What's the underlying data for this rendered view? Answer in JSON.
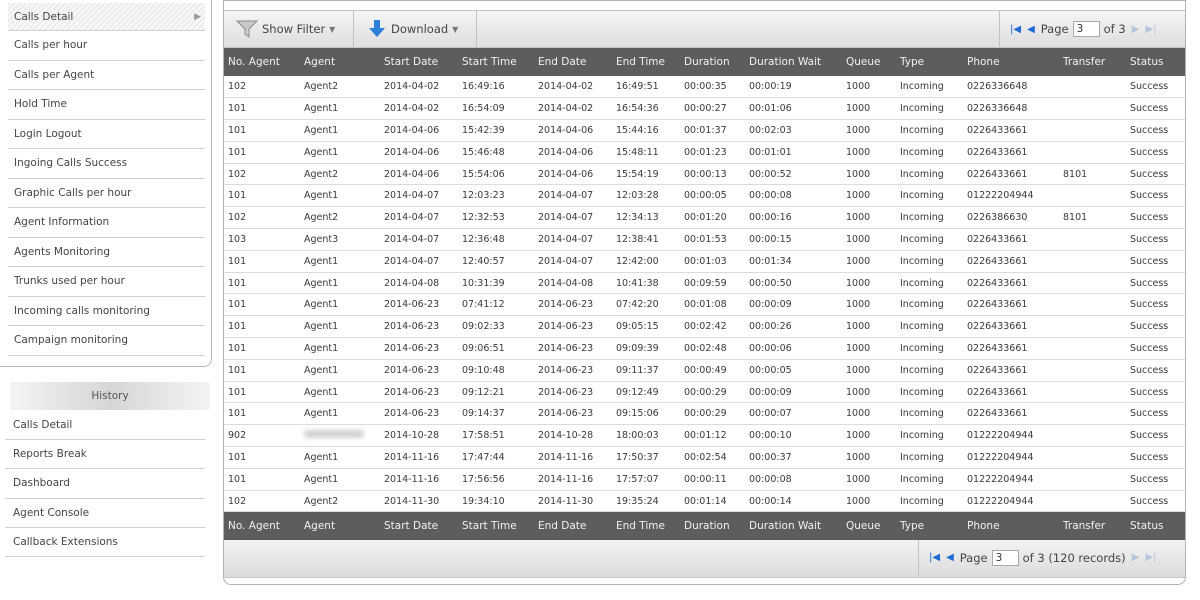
{
  "sidebar": {
    "reports": [
      {
        "label": "Calls Detail"
      },
      {
        "label": "Calls per hour"
      },
      {
        "label": "Calls per Agent"
      },
      {
        "label": "Hold Time"
      },
      {
        "label": "Login Logout"
      },
      {
        "label": "Ingoing Calls Success"
      },
      {
        "label": "Graphic Calls per hour"
      },
      {
        "label": "Agent Information"
      },
      {
        "label": "Agents Monitoring"
      },
      {
        "label": "Trunks used per hour"
      },
      {
        "label": "Incoming calls monitoring"
      },
      {
        "label": "Campaign monitoring"
      }
    ],
    "history_title": "History",
    "history": [
      {
        "label": "Calls Detail"
      },
      {
        "label": "Reports Break"
      },
      {
        "label": "Dashboard"
      },
      {
        "label": "Agent Console"
      },
      {
        "label": "Callback Extensions"
      }
    ]
  },
  "toolbar": {
    "show_filter": "Show Filter",
    "download": "Download",
    "page_label": "Page",
    "page_value": "3",
    "page_of": "of 3"
  },
  "columns": [
    "No. Agent",
    "Agent",
    "Start Date",
    "Start Time",
    "End Date",
    "End Time",
    "Duration",
    "Duration Wait",
    "Queue",
    "Type",
    "Phone",
    "Transfer",
    "Status"
  ],
  "rows": [
    [
      "102",
      "Agent2",
      "2014-04-02",
      "16:49:16",
      "2014-04-02",
      "16:49:51",
      "00:00:35",
      "00:00:19",
      "1000",
      "Incoming",
      "0226336648",
      "",
      "Success"
    ],
    [
      "101",
      "Agent1",
      "2014-04-02",
      "16:54:09",
      "2014-04-02",
      "16:54:36",
      "00:00:27",
      "00:01:06",
      "1000",
      "Incoming",
      "0226336648",
      "",
      "Success"
    ],
    [
      "101",
      "Agent1",
      "2014-04-06",
      "15:42:39",
      "2014-04-06",
      "15:44:16",
      "00:01:37",
      "00:02:03",
      "1000",
      "Incoming",
      "0226433661",
      "",
      "Success"
    ],
    [
      "101",
      "Agent1",
      "2014-04-06",
      "15:46:48",
      "2014-04-06",
      "15:48:11",
      "00:01:23",
      "00:01:01",
      "1000",
      "Incoming",
      "0226433661",
      "",
      "Success"
    ],
    [
      "102",
      "Agent2",
      "2014-04-06",
      "15:54:06",
      "2014-04-06",
      "15:54:19",
      "00:00:13",
      "00:00:52",
      "1000",
      "Incoming",
      "0226433661",
      "8101",
      "Success"
    ],
    [
      "101",
      "Agent1",
      "2014-04-07",
      "12:03:23",
      "2014-04-07",
      "12:03:28",
      "00:00:05",
      "00:00:08",
      "1000",
      "Incoming",
      "01222204944",
      "",
      "Success"
    ],
    [
      "102",
      "Agent2",
      "2014-04-07",
      "12:32:53",
      "2014-04-07",
      "12:34:13",
      "00:01:20",
      "00:00:16",
      "1000",
      "Incoming",
      "0226386630",
      "8101",
      "Success"
    ],
    [
      "103",
      "Agent3",
      "2014-04-07",
      "12:36:48",
      "2014-04-07",
      "12:38:41",
      "00:01:53",
      "00:00:15",
      "1000",
      "Incoming",
      "0226433661",
      "",
      "Success"
    ],
    [
      "101",
      "Agent1",
      "2014-04-07",
      "12:40:57",
      "2014-04-07",
      "12:42:00",
      "00:01:03",
      "00:01:34",
      "1000",
      "Incoming",
      "0226433661",
      "",
      "Success"
    ],
    [
      "101",
      "Agent1",
      "2014-04-08",
      "10:31:39",
      "2014-04-08",
      "10:41:38",
      "00:09:59",
      "00:00:50",
      "1000",
      "Incoming",
      "0226433661",
      "",
      "Success"
    ],
    [
      "101",
      "Agent1",
      "2014-06-23",
      "07:41:12",
      "2014-06-23",
      "07:42:20",
      "00:01:08",
      "00:00:09",
      "1000",
      "Incoming",
      "0226433661",
      "",
      "Success"
    ],
    [
      "101",
      "Agent1",
      "2014-06-23",
      "09:02:33",
      "2014-06-23",
      "09:05:15",
      "00:02:42",
      "00:00:26",
      "1000",
      "Incoming",
      "0226433661",
      "",
      "Success"
    ],
    [
      "101",
      "Agent1",
      "2014-06-23",
      "09:06:51",
      "2014-06-23",
      "09:09:39",
      "00:02:48",
      "00:00:06",
      "1000",
      "Incoming",
      "0226433661",
      "",
      "Success"
    ],
    [
      "101",
      "Agent1",
      "2014-06-23",
      "09:10:48",
      "2014-06-23",
      "09:11:37",
      "00:00:49",
      "00:00:05",
      "1000",
      "Incoming",
      "0226433661",
      "",
      "Success"
    ],
    [
      "101",
      "Agent1",
      "2014-06-23",
      "09:12:21",
      "2014-06-23",
      "09:12:49",
      "00:00:29",
      "00:00:09",
      "1000",
      "Incoming",
      "0226433661",
      "",
      "Success"
    ],
    [
      "101",
      "Agent1",
      "2014-06-23",
      "09:14:37",
      "2014-06-23",
      "09:15:06",
      "00:00:29",
      "00:00:07",
      "1000",
      "Incoming",
      "0226433661",
      "",
      "Success"
    ],
    [
      "902",
      "",
      "2014-10-28",
      "17:58:51",
      "2014-10-28",
      "18:00:03",
      "00:01:12",
      "00:00:10",
      "1000",
      "Incoming",
      "01222204944",
      "",
      "Success"
    ],
    [
      "101",
      "Agent1",
      "2014-11-16",
      "17:47:44",
      "2014-11-16",
      "17:50:37",
      "00:02:54",
      "00:00:37",
      "1000",
      "Incoming",
      "01222204944",
      "",
      "Success"
    ],
    [
      "101",
      "Agent1",
      "2014-11-16",
      "17:56:56",
      "2014-11-16",
      "17:57:07",
      "00:00:11",
      "00:00:08",
      "1000",
      "Incoming",
      "01222204944",
      "",
      "Success"
    ],
    [
      "102",
      "Agent2",
      "2014-11-30",
      "19:34:10",
      "2014-11-30",
      "19:35:24",
      "00:01:14",
      "00:00:14",
      "1000",
      "Incoming",
      "01222204944",
      "",
      "Success"
    ]
  ],
  "footer_pager": {
    "page_label": "Page",
    "page_value": "3",
    "page_of": "of 3 (120 records)"
  }
}
